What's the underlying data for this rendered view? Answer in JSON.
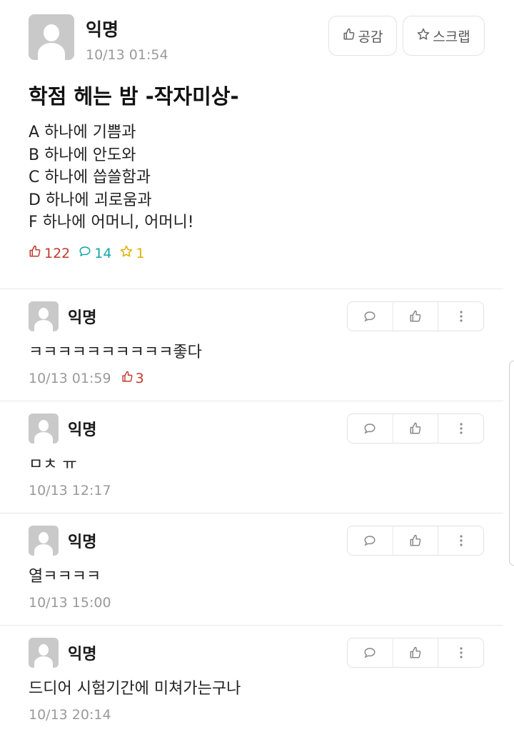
{
  "post": {
    "author": "익명",
    "date": "10/13 01:54",
    "like_button": "공감",
    "scrap_button": "스크랩",
    "title": "학점 헤는 밤 -작자미상-",
    "body_lines": [
      "A 하나에 기쁨과",
      "B 하나에 안도와",
      "C 하나에 씁쓸함과",
      "D 하나에 괴로움과",
      "F 하나에 어머니, 어머니!"
    ],
    "stats": {
      "likes": "122",
      "comments": "14",
      "scraps": "1"
    },
    "colors": {
      "likes": "#c0392b",
      "comments": "#14a6a6",
      "scraps": "#e0b000"
    },
    "icons": {
      "like": "thumbs-up-icon",
      "scrap": "star-icon",
      "comment": "speech-bubble-icon"
    }
  },
  "comments": [
    {
      "author": "익명",
      "text": "ㅋㅋㅋㅋㅋㅋㅋㅋㅋㅋ좋다",
      "time": "10/13 01:59",
      "likes": "3"
    },
    {
      "author": "익명",
      "text": "ㅁㅊ ㅠ",
      "time": "10/13 12:17",
      "likes": ""
    },
    {
      "author": "익명",
      "text": "열ㅋㅋㅋㅋ",
      "time": "10/13 15:00",
      "likes": ""
    },
    {
      "author": "익명",
      "text": "드디어 시험기간에 미쳐가는구나",
      "time": "10/13 20:14",
      "likes": ""
    }
  ]
}
